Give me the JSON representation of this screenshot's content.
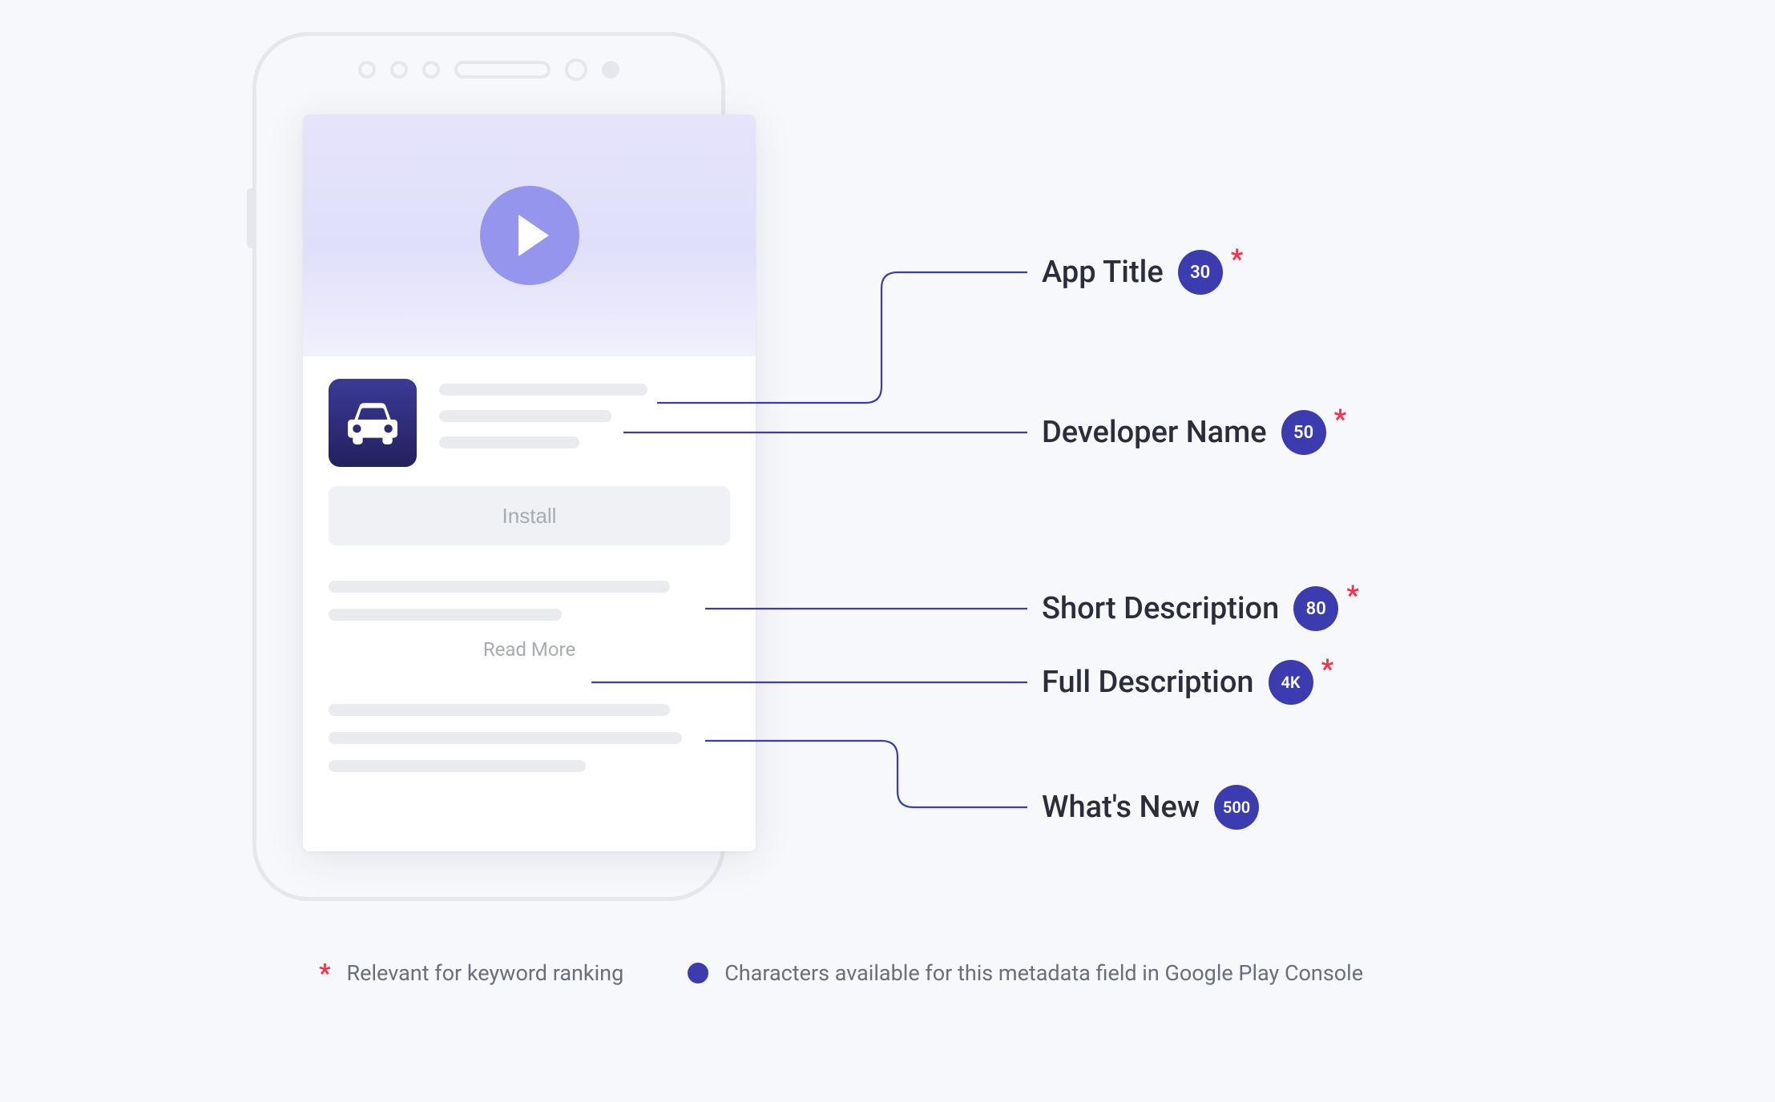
{
  "buttons": {
    "install": "Install",
    "read_more": "Read More"
  },
  "callouts": [
    {
      "label": "App Title",
      "limit": "30",
      "starred": true
    },
    {
      "label": "Developer Name",
      "limit": "50",
      "starred": true
    },
    {
      "label": "Short Description",
      "limit": "80",
      "starred": true
    },
    {
      "label": "Full Description",
      "limit": "4K",
      "starred": true
    },
    {
      "label": "What's New",
      "limit": "500",
      "starred": false
    }
  ],
  "legend": {
    "asterisk": "Relevant for keyword ranking",
    "dot": "Characters available for this metadata field in Google Play Console"
  },
  "icons": {
    "play": "play-icon",
    "app": "car-icon"
  },
  "colors": {
    "badge": "#3d3bb0",
    "accent_light": "#9695ee",
    "asterisk": "#ff2e4a",
    "text_dark": "#2b2d3c",
    "text_muted": "#6a6e7d"
  }
}
